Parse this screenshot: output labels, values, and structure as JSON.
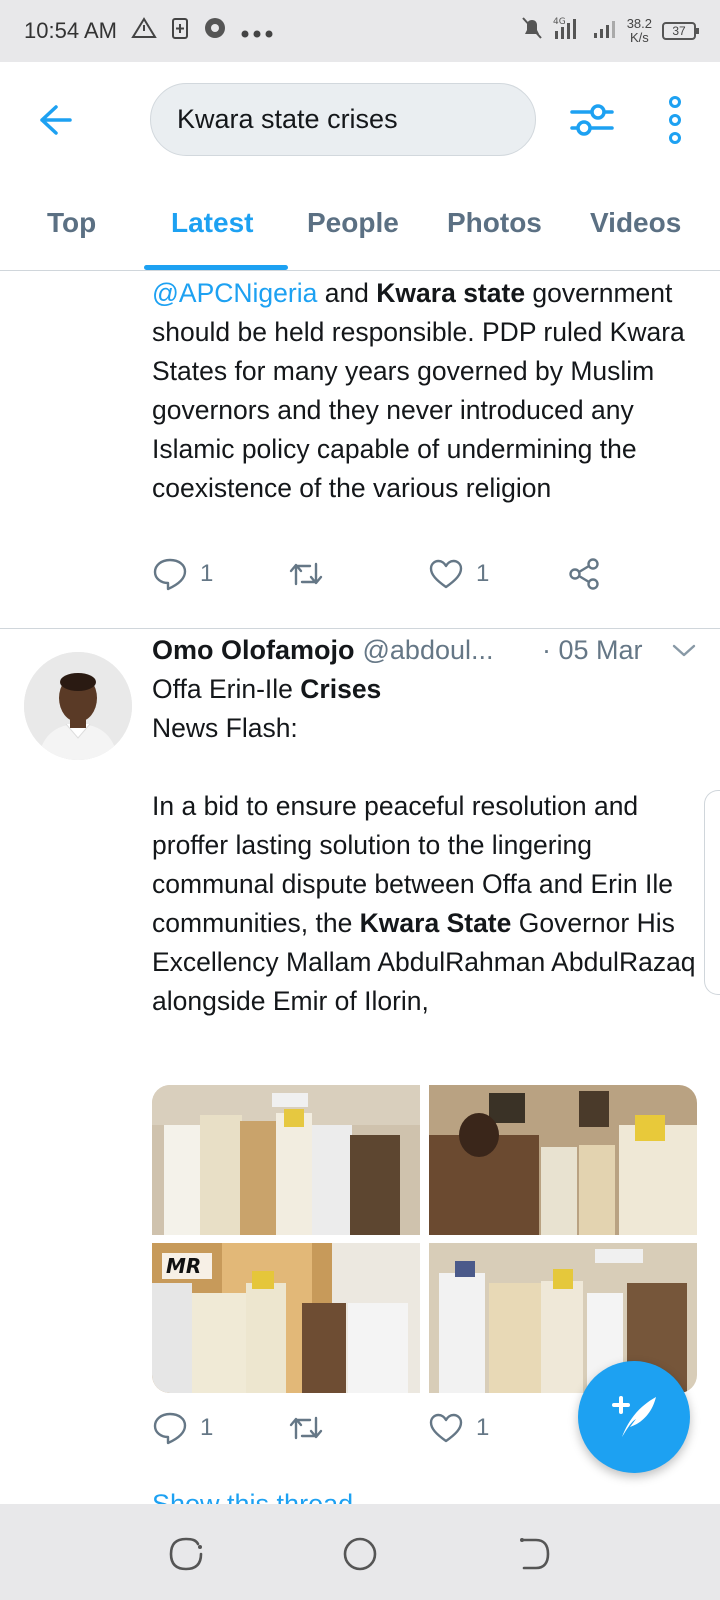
{
  "status_bar": {
    "time": "10:54 AM",
    "net_speed_value": "38.2",
    "net_speed_unit": "K/s",
    "battery": "37",
    "signal_label": "4G"
  },
  "search": {
    "query": "Kwara state crises"
  },
  "tabs": [
    {
      "label": "Top",
      "active": false
    },
    {
      "label": "Latest",
      "active": true
    },
    {
      "label": "People",
      "active": false
    },
    {
      "label": "Photos",
      "active": false
    },
    {
      "label": "Videos",
      "active": false
    }
  ],
  "tweets": [
    {
      "text_parts": [
        {
          "text": "@APCNigeria",
          "style": "mention"
        },
        {
          "text": " and ",
          "style": "plain"
        },
        {
          "text": "Kwara state",
          "style": "bold"
        },
        {
          "text": " government should be held responsible. PDP ruled Kwara States for many years governed by Muslim governors and they never introduced any Islamic policy capable of undermining the coexistence of the various religion",
          "style": "plain"
        }
      ],
      "replies": "1",
      "likes": "1"
    },
    {
      "name": "Omo Olofamojo",
      "handle": "@abdoul...",
      "date": "· 05 Mar",
      "text_parts": [
        {
          "text": "Offa Erin-Ile ",
          "style": "plain"
        },
        {
          "text": "Crises",
          "style": "bold"
        },
        {
          "text": "\nNews Flash:\n\nIn a bid to ensure peaceful resolution and proffer lasting solution to the lingering communal dispute between Offa and Erin Ile communities, the ",
          "style": "plain"
        },
        {
          "text": "Kwara State",
          "style": "bold"
        },
        {
          "text": " Governor His Excellency Mallam AbdulRahman AbdulRazaq alongside Emir of Ilorin,",
          "style": "plain"
        }
      ],
      "photo_watermark": "MR",
      "replies": "1",
      "likes": "1",
      "show_thread": "Show this thread"
    }
  ],
  "colors": {
    "accent": "#1da1f2",
    "muted": "#657786",
    "text": "#14171a"
  }
}
